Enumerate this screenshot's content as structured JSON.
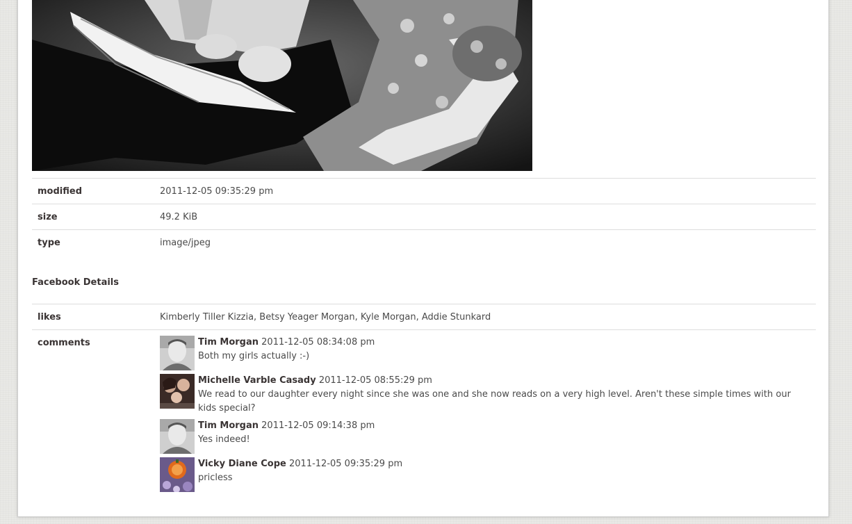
{
  "file_details": [
    {
      "label": "modified",
      "value": "2011-12-05 09:35:29 pm"
    },
    {
      "label": "size",
      "value": "49.2 KiB"
    },
    {
      "label": "type",
      "value": "image/jpeg"
    }
  ],
  "facebook": {
    "title": "Facebook Details",
    "likes_label": "likes",
    "likes_value": "Kimberly Tiller Kizzia, Betsy Yeager Morgan, Kyle Morgan, Addie Stunkard",
    "comments_label": "comments",
    "comments": [
      {
        "author": "Tim Morgan",
        "time": "2011-12-05 08:34:08 pm",
        "text": "Both my girls actually :-)",
        "avatar": "tim-avatar"
      },
      {
        "author": "Michelle Varble Casady",
        "time": "2011-12-05 08:55:29 pm",
        "text": "We read to our daughter every night since she was one and she now reads on a very high level. Aren't these simple times with our kids special?",
        "avatar": "michelle-avatar"
      },
      {
        "author": "Tim Morgan",
        "time": "2011-12-05 09:14:38 pm",
        "text": "Yes indeed!",
        "avatar": "tim-avatar"
      },
      {
        "author": "Vicky Diane Cope",
        "time": "2011-12-05 09:35:29 pm",
        "text": "pricless",
        "avatar": "vicky-avatar"
      }
    ]
  }
}
